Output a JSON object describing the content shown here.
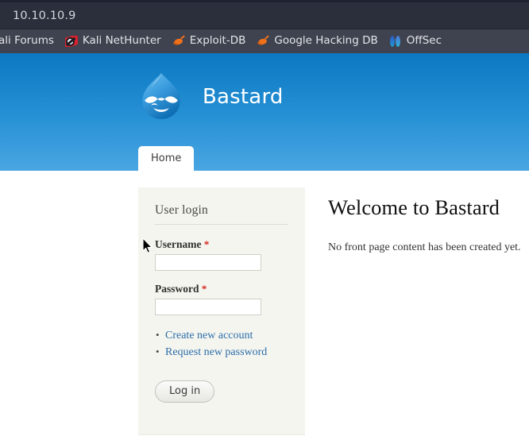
{
  "browser": {
    "url": "10.10.10.9",
    "bookmarks": [
      {
        "label": "ali Forums",
        "icon": "none-icon"
      },
      {
        "label": "Kali NetHunter",
        "icon": "kali-nethunter-icon"
      },
      {
        "label": "Exploit-DB",
        "icon": "exploit-db-icon"
      },
      {
        "label": "Google Hacking DB",
        "icon": "google-hacking-db-icon"
      },
      {
        "label": "OffSec",
        "icon": "offsec-icon"
      }
    ]
  },
  "site": {
    "name": "Bastard",
    "logo": "drupal-droplet-logo",
    "header_gradient_top": "#0b78c2",
    "header_gradient_bottom": "#4aa6e2"
  },
  "nav": {
    "tabs": [
      {
        "label": "Home",
        "active": true
      }
    ]
  },
  "sidebar": {
    "block_title": "User login",
    "fields": [
      {
        "label": "Username",
        "required_marker": "*",
        "value": "",
        "placeholder": ""
      },
      {
        "label": "Password",
        "required_marker": "*",
        "value": "",
        "placeholder": ""
      }
    ],
    "links": [
      {
        "label": "Create new account"
      },
      {
        "label": "Request new password"
      }
    ],
    "submit_label": "Log in",
    "link_color": "#2b6ea8",
    "required_color": "#d4231b",
    "background": "#f5f5f0"
  },
  "main": {
    "title": "Welcome to Bastard",
    "body": "No front page content has been created yet."
  }
}
